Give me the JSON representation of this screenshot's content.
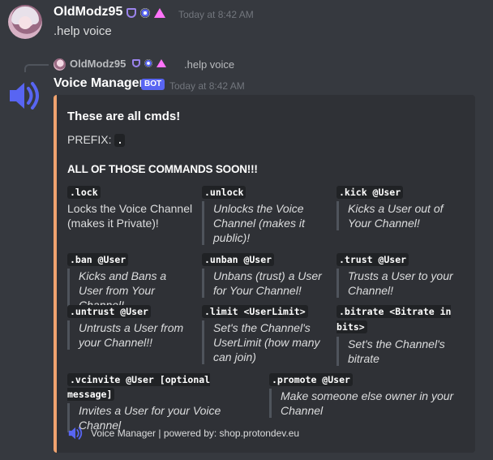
{
  "user_message": {
    "username": "OldModz95",
    "badges": [
      "shield-badge-icon",
      "nitro-badge-icon",
      "booster-triangle-icon"
    ],
    "timestamp": "Today at 8:42 AM",
    "content": ".help voice"
  },
  "bot_message": {
    "reply": {
      "username": "OldModz95",
      "text": ".help voice"
    },
    "bot_name": "Voice Manager",
    "bot_tag": "BOT",
    "timestamp": "Today at 8:42 AM",
    "colors": {
      "embed_accent": "#f0a36f",
      "bot_avatar": "#5865f2",
      "bot_tag_bg": "#5865f2",
      "background": "#36393f",
      "embed_bg": "#2f3136"
    },
    "embed": {
      "title": "These are all cmds!",
      "prefix_label": "PREFIX:",
      "prefix_value": ".",
      "section_heading": "ALL OF THOSE COMMANDS SOON!!!",
      "fields": [
        {
          "command": ".lock",
          "description": "Locks the Voice Channel (makes it Private)!"
        },
        {
          "command": ".unlock",
          "description": "Unlocks the Voice Channel (makes it public)!"
        },
        {
          "command": ".kick @User",
          "description": "Kicks a User out of Your Channel!"
        },
        {
          "command": ".ban @User",
          "description": "Kicks and Bans a User from Your Channel!"
        },
        {
          "command": ".unban @User",
          "description": "Unbans (trust) a User for Your Channel!"
        },
        {
          "command": ".trust @User",
          "description": "Trusts a User to your Channel!"
        },
        {
          "command": ".untrust @User",
          "description": "Untrusts a User from your Channel!!"
        },
        {
          "command": ".limit <UserLimit>",
          "description": "Set's the Channel's UserLimit (how many can join)"
        },
        {
          "command": ".bitrate <Bitrate in bits>",
          "description": "Set's the Channel's bitrate"
        },
        {
          "command": ".vcinvite @User [optional message]",
          "description": "Invites a User for your Voice Channel"
        },
        {
          "command": ".promote @User",
          "description": "Make someone else owner in your Channel"
        }
      ],
      "footer": {
        "icon": "speaker-icon",
        "text": "Voice Manager | powered by: shop.protondev.eu"
      }
    }
  }
}
